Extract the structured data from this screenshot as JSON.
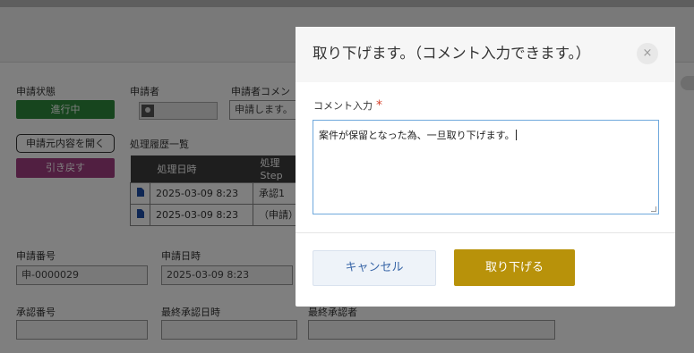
{
  "page": {
    "status_label": "申請状態",
    "status_value": "進行中",
    "applicant_label": "申請者",
    "applicant_comment_label": "申請者コメン",
    "applicant_comment_value": "申請します。",
    "open_original_button": "申請元内容を開く",
    "pull_back_button": "引き戻す",
    "history_title": "処理履歴一覧",
    "history_headers": [
      "処理日時",
      "処理Step"
    ],
    "history_rows": [
      {
        "datetime": "2025-03-09 8:23",
        "step": "承認1"
      },
      {
        "datetime": "2025-03-09 8:23",
        "step": "（申請）"
      }
    ],
    "request_no_label": "申請番号",
    "request_no_value": "申-0000029",
    "request_date_label": "申請日時",
    "request_date_value": "2025-03-09 8:23",
    "approval_no_label": "承認番号",
    "approval_no_value": "",
    "last_approval_date_label": "最終承認日時",
    "last_approval_date_value": "",
    "last_approver_label": "最終承認者",
    "last_approver_value": ""
  },
  "modal": {
    "title": "取り下げます。（コメント入力できます。）",
    "close_icon": "×",
    "comment_label": "コメント入力",
    "required_mark": "*",
    "comment_value": "案件が保留となった為、一旦取り下げます。",
    "cancel_label": "キャンセル",
    "withdraw_label": "取り下げる"
  },
  "colors": {
    "status_green": "#2e8b3c",
    "pull_back_purple": "#a33e82",
    "withdraw_gold": "#b8920a",
    "cancel_blue_text": "#3a67a8",
    "required_red": "#d6452f"
  }
}
